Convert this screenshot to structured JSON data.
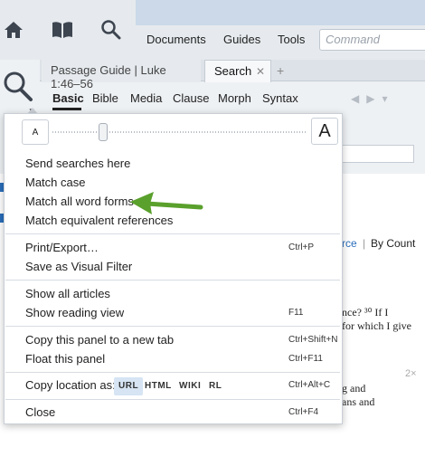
{
  "toolbar": {
    "menus": [
      "Documents",
      "Guides",
      "Tools"
    ],
    "command_placeholder": "Command",
    "icons": [
      "home-icon",
      "library-book-icon",
      "search-icon"
    ]
  },
  "tabs": {
    "passage": "Passage Guide | Luke 1:46–56",
    "search": "Search",
    "close": "✕",
    "add": "+"
  },
  "subtabs": [
    "Basic",
    "Bible",
    "Media",
    "Clause",
    "Morph",
    "Syntax"
  ],
  "font_size": {
    "small_label": "A",
    "big_label": "A",
    "level": 0.2
  },
  "menu": {
    "group1": [
      "Send searches here",
      "Match case",
      "Match all word forms",
      "Match equivalent references"
    ],
    "print_export": "Print/Export…",
    "print_shortcut": "Ctrl+P",
    "save_visual_filter": "Save as Visual Filter",
    "show_all_articles": "Show all articles",
    "show_reading_view": "Show reading view",
    "reading_shortcut": "F11",
    "copy_panel": "Copy this panel to a new tab",
    "copy_panel_shortcut": "Ctrl+Shift+N",
    "float_panel": "Float this panel",
    "float_shortcut": "Ctrl+F11",
    "copy_location_label": "Copy location as:",
    "copy_formats": [
      "URL",
      "HTML",
      "WIKI",
      "RL"
    ],
    "copy_location_shortcut": "Ctrl+Alt+C",
    "close": "Close",
    "close_shortcut": "Ctrl+F4"
  },
  "background": {
    "source_link": "rce",
    "separator": "|",
    "by_count": "By Count",
    "line1": "nce? ³⁰ If I",
    "line2": "for which I give",
    "line3": "g and",
    "line4": "ans and",
    "zoom_badge": "2×"
  },
  "colors": {
    "accent_blue": "#2a6ebb",
    "arrow_green": "#5aa02c"
  }
}
